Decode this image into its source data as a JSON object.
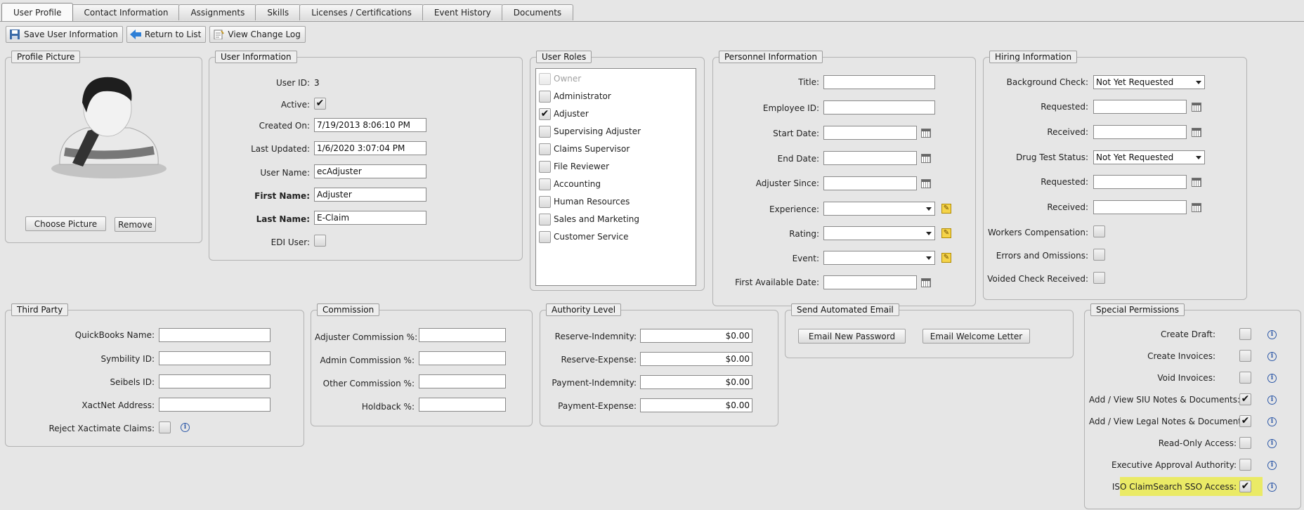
{
  "tabs": [
    "User Profile",
    "Contact Information",
    "Assignments",
    "Skills",
    "Licenses / Certifications",
    "Event History",
    "Documents"
  ],
  "toolbar": {
    "save": "Save User Information",
    "return": "Return to List",
    "log": "View Change Log"
  },
  "profile_picture": {
    "legend": "Profile Picture",
    "choose": "Choose Picture",
    "remove": "Remove"
  },
  "user_info": {
    "legend": "User Information",
    "user_id_label": "User ID:",
    "user_id": "3",
    "active_label": "Active:",
    "active": "✔",
    "created_label": "Created On:",
    "created": "7/19/2013 8:06:10 PM",
    "updated_label": "Last Updated:",
    "updated": "1/6/2020 3:07:04 PM",
    "username_label": "User Name:",
    "username": "ecAdjuster",
    "first_label": "First Name:",
    "first": "Adjuster",
    "last_label": "Last Name:",
    "last": "E-Claim",
    "edi_label": "EDI User:"
  },
  "roles": {
    "legend": "User Roles",
    "items": [
      {
        "label": "Owner",
        "checked": false,
        "disabled": true
      },
      {
        "label": "Administrator",
        "checked": false
      },
      {
        "label": "Adjuster",
        "checked": true
      },
      {
        "label": "Supervising Adjuster",
        "checked": false
      },
      {
        "label": "Claims Supervisor",
        "checked": false
      },
      {
        "label": "File Reviewer",
        "checked": false
      },
      {
        "label": "Accounting",
        "checked": false
      },
      {
        "label": "Human Resources",
        "checked": false
      },
      {
        "label": "Sales and Marketing",
        "checked": false
      },
      {
        "label": "Customer Service",
        "checked": false
      }
    ]
  },
  "personnel": {
    "legend": "Personnel Information",
    "title": "Title:",
    "employee_id": "Employee ID:",
    "start": "Start Date:",
    "end": "End Date:",
    "adjuster_since": "Adjuster Since:",
    "experience": "Experience:",
    "rating": "Rating:",
    "event": "Event:",
    "first_available": "First Available Date:"
  },
  "hiring": {
    "legend": "Hiring Information",
    "bg_check": "Background Check:",
    "bg_value": "Not Yet Requested",
    "requested": "Requested:",
    "received": "Received:",
    "drug": "Drug Test Status:",
    "drug_value": "Not Yet Requested",
    "workers": "Workers Compensation:",
    "errors": "Errors and Omissions:",
    "voided": "Voided Check Received:"
  },
  "third_party": {
    "legend": "Third Party",
    "qb": "QuickBooks Name:",
    "symbility": "Symbility ID:",
    "seibels": "Seibels ID:",
    "xactnet": "XactNet Address:",
    "reject": "Reject Xactimate Claims:"
  },
  "commission": {
    "legend": "Commission",
    "adjuster": "Adjuster Commission %:",
    "admin": "Admin Commission %:",
    "other": "Other Commission %:",
    "holdback": "Holdback %:"
  },
  "authority": {
    "legend": "Authority Level",
    "rows": [
      {
        "label": "Reserve-Indemnity:",
        "value": "$0.00"
      },
      {
        "label": "Reserve-Expense:",
        "value": "$0.00"
      },
      {
        "label": "Payment-Indemnity:",
        "value": "$0.00"
      },
      {
        "label": "Payment-Expense:",
        "value": "$0.00"
      }
    ]
  },
  "email": {
    "legend": "Send Automated Email",
    "new_password": "Email New Password",
    "welcome": "Email Welcome Letter"
  },
  "special": {
    "legend": "Special Permissions",
    "rows": [
      {
        "label": "Create Draft:",
        "checked": false
      },
      {
        "label": "Create Invoices:",
        "checked": false
      },
      {
        "label": "Void Invoices:",
        "checked": false
      },
      {
        "label": "Add / View SIU Notes & Documents:",
        "checked": true
      },
      {
        "label": "Add / View Legal Notes & Documents:",
        "checked": true
      },
      {
        "label": "Read-Only Access:",
        "checked": false
      },
      {
        "label": "Executive Approval Authority:",
        "checked": false
      },
      {
        "label": "ISO ClaimSearch SSO Access:",
        "checked": true
      }
    ],
    "highlight_color": "#eaea66"
  },
  "colors": {
    "background": "#e6e6e6",
    "info_icon": "#2f5aa8"
  }
}
